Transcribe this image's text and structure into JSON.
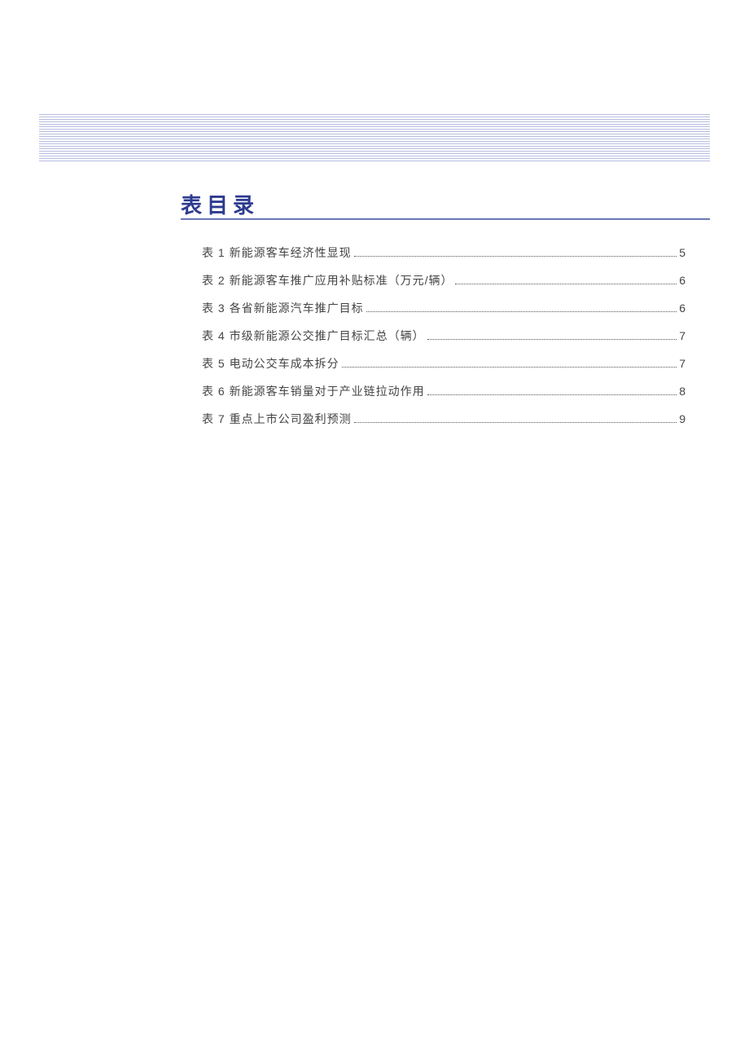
{
  "heading": "表目录",
  "toc": {
    "items": [
      {
        "label": "表 1 新能源客车经济性显现",
        "page": "5"
      },
      {
        "label": "表 2 新能源客车推广应用补贴标准（万元/辆）",
        "page": "6"
      },
      {
        "label": "表 3 各省新能源汽车推广目标",
        "page": "6"
      },
      {
        "label": "表 4 市级新能源公交推广目标汇总（辆）",
        "page": "7"
      },
      {
        "label": "表 5 电动公交车成本拆分",
        "page": "7"
      },
      {
        "label": "表 6 新能源客车销量对于产业链拉动作用",
        "page": "8"
      },
      {
        "label": "表 7 重点上市公司盈利预测",
        "page": "9"
      }
    ]
  }
}
